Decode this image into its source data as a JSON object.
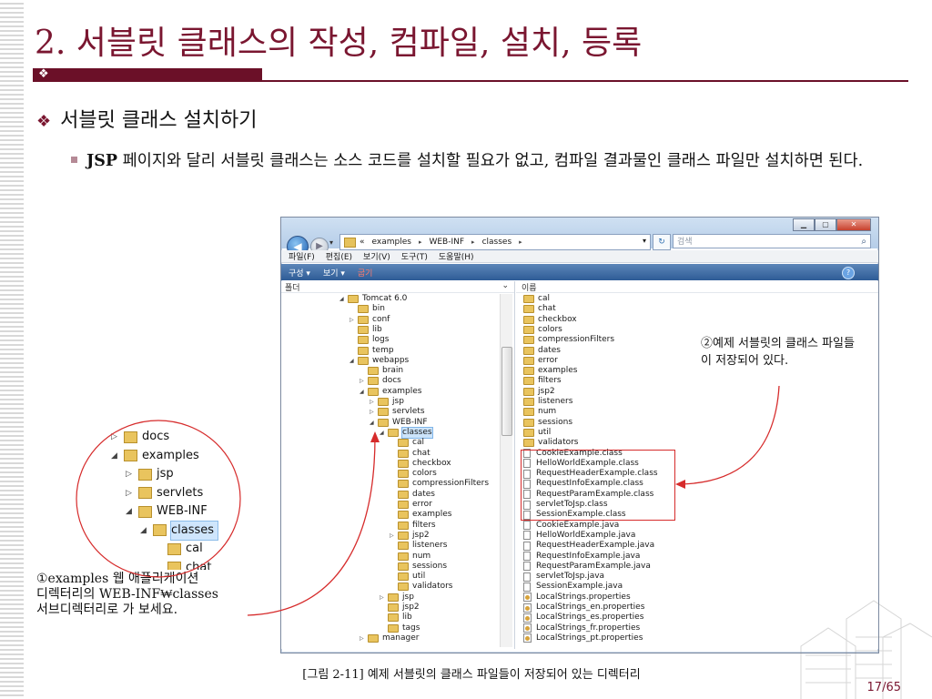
{
  "slide": {
    "title": "2. 서블릿 클래스의 작성, 컴파일, 설치, 등록",
    "title_diamond": "❖",
    "bullet1": "서블릿 클래스 설치하기",
    "bullet1_mark": "❖",
    "bullet2_strong": "JSP",
    "bullet2_text": " 페이지와 달리 서블릿 클래스는 소스 코드를 설치할 필요가 없고, 컴파일 결과물인 클래스 파일만 설치하면 된다.",
    "caption": "[그림 2-11] 예제 서블릿의 클래스 파일들이 저장되어 있는 디렉터리",
    "page_number": "17/65",
    "accent_color": "#7a1630"
  },
  "annotations": {
    "note1": "①examples 웹 애플리케이션\n디렉터리의 WEB-INF₩classes\n서브디렉터리로 가 보세요.",
    "note2": "②예제 서블릿의 클래스 파일들이 저장되어 있다."
  },
  "explorer": {
    "address": {
      "prefix": "«",
      "crumbs": [
        "examples",
        "WEB-INF",
        "classes"
      ],
      "sep": "▸"
    },
    "search_placeholder": "검색",
    "menu": [
      "파일(F)",
      "편집(E)",
      "보기(V)",
      "도구(T)",
      "도움말(H)"
    ],
    "toolbar": [
      "구성 ▾",
      "보기 ▾",
      "굽기"
    ],
    "left_header": "폴더",
    "right_header": "이름",
    "tree": [
      {
        "label": "Tomcat 6.0",
        "depth": 0,
        "exp": "open"
      },
      {
        "label": "bin",
        "depth": 1,
        "exp": "none"
      },
      {
        "label": "conf",
        "depth": 1,
        "exp": "closed"
      },
      {
        "label": "lib",
        "depth": 1,
        "exp": "none"
      },
      {
        "label": "logs",
        "depth": 1,
        "exp": "none"
      },
      {
        "label": "temp",
        "depth": 1,
        "exp": "none"
      },
      {
        "label": "webapps",
        "depth": 1,
        "exp": "open"
      },
      {
        "label": "brain",
        "depth": 2,
        "exp": "none"
      },
      {
        "label": "docs",
        "depth": 2,
        "exp": "closed"
      },
      {
        "label": "examples",
        "depth": 2,
        "exp": "open"
      },
      {
        "label": "jsp",
        "depth": 3,
        "exp": "closed"
      },
      {
        "label": "servlets",
        "depth": 3,
        "exp": "closed"
      },
      {
        "label": "WEB-INF",
        "depth": 3,
        "exp": "open"
      },
      {
        "label": "classes",
        "depth": 4,
        "exp": "open",
        "selected": true
      },
      {
        "label": "cal",
        "depth": 5,
        "exp": "none"
      },
      {
        "label": "chat",
        "depth": 5,
        "exp": "none"
      },
      {
        "label": "checkbox",
        "depth": 5,
        "exp": "none"
      },
      {
        "label": "colors",
        "depth": 5,
        "exp": "none"
      },
      {
        "label": "compressionFilters",
        "depth": 5,
        "exp": "none"
      },
      {
        "label": "dates",
        "depth": 5,
        "exp": "none"
      },
      {
        "label": "error",
        "depth": 5,
        "exp": "none"
      },
      {
        "label": "examples",
        "depth": 5,
        "exp": "none"
      },
      {
        "label": "filters",
        "depth": 5,
        "exp": "none"
      },
      {
        "label": "jsp2",
        "depth": 5,
        "exp": "closed"
      },
      {
        "label": "listeners",
        "depth": 5,
        "exp": "none"
      },
      {
        "label": "num",
        "depth": 5,
        "exp": "none"
      },
      {
        "label": "sessions",
        "depth": 5,
        "exp": "none"
      },
      {
        "label": "util",
        "depth": 5,
        "exp": "none"
      },
      {
        "label": "validators",
        "depth": 5,
        "exp": "none"
      },
      {
        "label": "jsp",
        "depth": 4,
        "exp": "closed"
      },
      {
        "label": "jsp2",
        "depth": 4,
        "exp": "none"
      },
      {
        "label": "lib",
        "depth": 4,
        "exp": "none"
      },
      {
        "label": "tags",
        "depth": 4,
        "exp": "none"
      },
      {
        "label": "manager",
        "depth": 2,
        "exp": "closed"
      }
    ],
    "files": [
      {
        "name": "cal",
        "kind": "folder"
      },
      {
        "name": "chat",
        "kind": "folder"
      },
      {
        "name": "checkbox",
        "kind": "folder"
      },
      {
        "name": "colors",
        "kind": "folder"
      },
      {
        "name": "compressionFilters",
        "kind": "folder"
      },
      {
        "name": "dates",
        "kind": "folder"
      },
      {
        "name": "error",
        "kind": "folder"
      },
      {
        "name": "examples",
        "kind": "folder"
      },
      {
        "name": "filters",
        "kind": "folder"
      },
      {
        "name": "jsp2",
        "kind": "folder"
      },
      {
        "name": "listeners",
        "kind": "folder"
      },
      {
        "name": "num",
        "kind": "folder"
      },
      {
        "name": "sessions",
        "kind": "folder"
      },
      {
        "name": "util",
        "kind": "folder"
      },
      {
        "name": "validators",
        "kind": "folder"
      },
      {
        "name": "CookieExample.class",
        "kind": "class"
      },
      {
        "name": "HelloWorldExample.class",
        "kind": "class"
      },
      {
        "name": "RequestHeaderExample.class",
        "kind": "class"
      },
      {
        "name": "RequestInfoExample.class",
        "kind": "class"
      },
      {
        "name": "RequestParamExample.class",
        "kind": "class"
      },
      {
        "name": "servletToJsp.class",
        "kind": "class"
      },
      {
        "name": "SessionExample.class",
        "kind": "class"
      },
      {
        "name": "CookieExample.java",
        "kind": "java"
      },
      {
        "name": "HelloWorldExample.java",
        "kind": "java"
      },
      {
        "name": "RequestHeaderExample.java",
        "kind": "java"
      },
      {
        "name": "RequestInfoExample.java",
        "kind": "java"
      },
      {
        "name": "RequestParamExample.java",
        "kind": "java"
      },
      {
        "name": "servletToJsp.java",
        "kind": "java"
      },
      {
        "name": "SessionExample.java",
        "kind": "java"
      },
      {
        "name": "LocalStrings.properties",
        "kind": "prop"
      },
      {
        "name": "LocalStrings_en.properties",
        "kind": "prop"
      },
      {
        "name": "LocalStrings_es.properties",
        "kind": "prop"
      },
      {
        "name": "LocalStrings_fr.properties",
        "kind": "prop"
      },
      {
        "name": "LocalStrings_pt.properties",
        "kind": "prop"
      }
    ]
  },
  "inset_tree": [
    {
      "label": "docs",
      "exp": "closed",
      "depth": 0
    },
    {
      "label": "examples",
      "exp": "open",
      "depth": 0
    },
    {
      "label": "jsp",
      "exp": "closed",
      "depth": 1
    },
    {
      "label": "servlets",
      "exp": "closed",
      "depth": 1
    },
    {
      "label": "WEB-INF",
      "exp": "open",
      "depth": 1
    },
    {
      "label": "classes",
      "exp": "open",
      "depth": 2,
      "selected": true
    },
    {
      "label": "cal",
      "exp": "none",
      "depth": 3
    },
    {
      "label": "chat",
      "exp": "none",
      "depth": 3
    }
  ]
}
